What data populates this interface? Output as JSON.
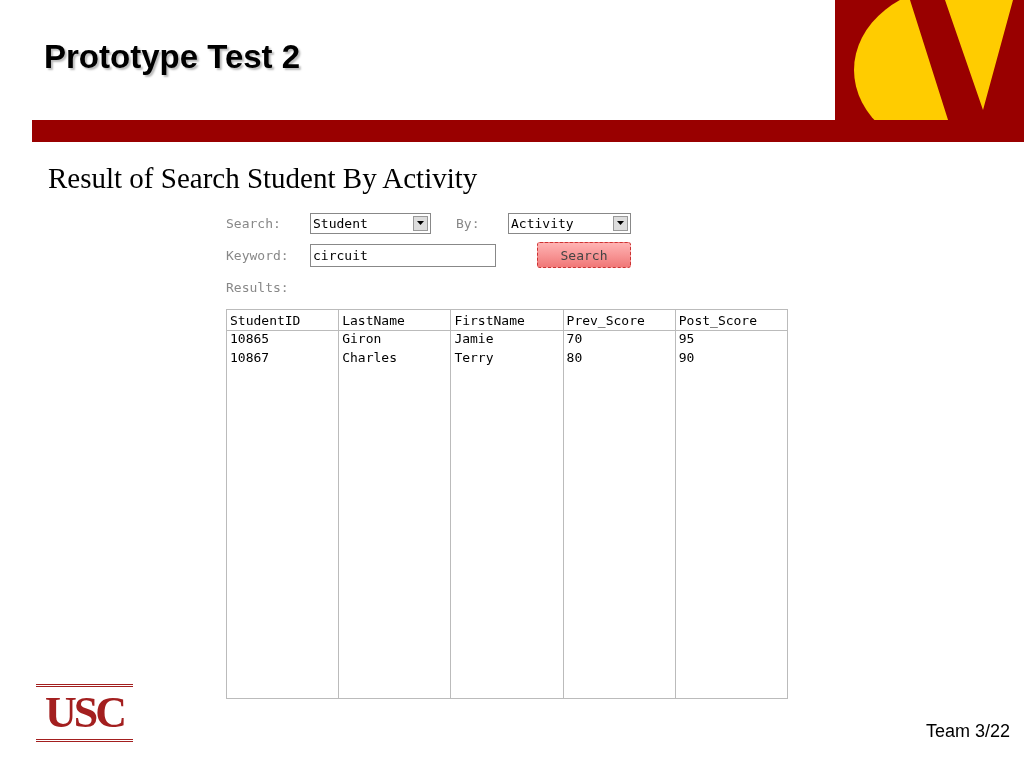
{
  "slide": {
    "title": "Prototype Test 2",
    "subtitle": "Result of Search Student By Activity",
    "footer_logo": "USC",
    "page": "Team 3/22"
  },
  "form": {
    "search_label": "Search:",
    "search_value": "Student",
    "by_label": "By:",
    "by_value": "Activity",
    "keyword_label": "Keyword:",
    "keyword_value": "circuit",
    "button": "Search",
    "results_label": "Results:"
  },
  "table": {
    "columns": [
      "StudentID",
      "LastName",
      "FirstName",
      "Prev_Score",
      "Post_Score"
    ],
    "rows": [
      [
        "10865",
        "Giron",
        "Jamie",
        "70",
        "95"
      ],
      [
        "10867",
        "Charles",
        "Terry",
        "80",
        "90"
      ]
    ]
  }
}
